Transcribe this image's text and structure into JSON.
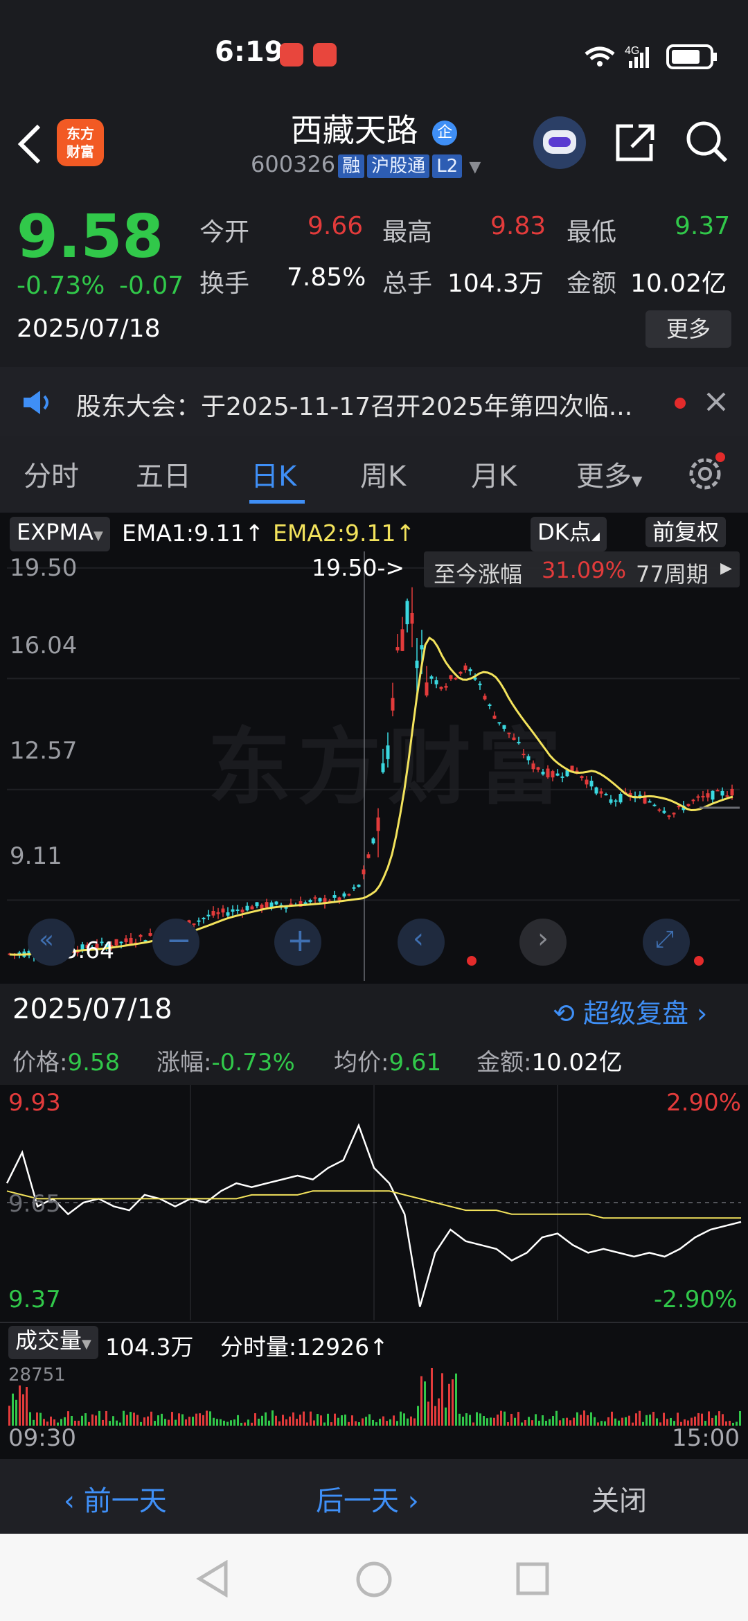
{
  "status_bar": {
    "time": "6:19",
    "network": "4G"
  },
  "header": {
    "title": "西藏天路",
    "title_badge": "企",
    "code": "600326",
    "tags": [
      "融",
      "沪股通",
      "L2"
    ],
    "logo_line1": "东方",
    "logo_line2": "财富"
  },
  "quote": {
    "price": "9.58",
    "change_pct": "-0.73%",
    "change": "-0.07",
    "date": "2025/07/18",
    "open_label": "今开",
    "open": "9.66",
    "high_label": "最高",
    "high": "9.83",
    "low_label": "最低",
    "low": "9.37",
    "turnover_label": "换手",
    "turnover": "7.85%",
    "volume_label": "总手",
    "volume": "104.3万",
    "amount_label": "金额",
    "amount": "10.02亿",
    "more_label": "更多"
  },
  "notice": {
    "text": "股东大会：于2025-11-17召开2025年第四次临..."
  },
  "tabs": [
    {
      "label": "分时"
    },
    {
      "label": "五日"
    },
    {
      "label": "日K"
    },
    {
      "label": "周K"
    },
    {
      "label": "月K"
    },
    {
      "label": "更多"
    }
  ],
  "kline": {
    "indicator": "EXPMA",
    "ema1": "EMA1:9.11↑",
    "ema2": "EMA2:9.11↑",
    "dk_label": "DK点",
    "adjust_label": "前复权",
    "y_ticks": [
      "19.50",
      "16.04",
      "12.57",
      "9.11"
    ],
    "max_marker": "19.50->",
    "min_marker": "<-5.64",
    "range_label": "至今涨幅",
    "range_value": "31.09%",
    "range_period": "77周期",
    "watermark": "东方财富"
  },
  "chart_data": {
    "type": "line",
    "title": "",
    "x": [
      "09:30",
      "",
      "",
      "",
      "",
      "",
      "",
      "",
      "",
      "",
      "",
      "",
      "",
      "",
      "",
      "",
      "",
      "",
      "",
      "",
      "",
      "",
      "",
      "",
      "",
      "",
      "",
      "",
      "",
      "",
      "",
      "",
      "",
      "",
      "",
      "",
      "",
      "",
      "",
      "",
      "",
      "",
      "",
      "",
      "",
      "",
      "",
      "",
      "15:00"
    ],
    "series": [
      {
        "name": "",
        "values": [
          9.7,
          9.78,
          9.64,
          9.66,
          9.62,
          9.65,
          9.66,
          9.64,
          9.63,
          9.67,
          9.66,
          9.64,
          9.66,
          9.65,
          9.68,
          9.7,
          9.69,
          9.7,
          9.71,
          9.72,
          9.71,
          9.74,
          9.76,
          9.85,
          9.74,
          9.7,
          9.62,
          9.38,
          9.52,
          9.58,
          9.55,
          9.54,
          9.53,
          9.5,
          9.52,
          9.56,
          9.57,
          9.54,
          9.52,
          9.53,
          9.52,
          9.51,
          9.52,
          9.51,
          9.53,
          9.56,
          9.58,
          9.59,
          9.6
        ]
      },
      {
        "name": "均价",
        "values": [
          9.68,
          9.67,
          9.66,
          9.66,
          9.66,
          9.66,
          9.66,
          9.66,
          9.66,
          9.66,
          9.66,
          9.66,
          9.66,
          9.66,
          9.66,
          9.66,
          9.67,
          9.67,
          9.67,
          9.67,
          9.68,
          9.68,
          9.68,
          9.68,
          9.68,
          9.68,
          9.67,
          9.66,
          9.65,
          9.64,
          9.63,
          9.63,
          9.63,
          9.62,
          9.62,
          9.62,
          9.62,
          9.62,
          9.62,
          9.61,
          9.61,
          9.61,
          9.61,
          9.61,
          9.61,
          9.61,
          9.61,
          9.61,
          9.61
        ]
      }
    ],
    "ylim": [
      9.37,
      9.93
    ],
    "y_ticks": [
      "9.93",
      "9.65",
      "9.37"
    ],
    "y_ticks_right": [
      "2.90%",
      "-2.90%"
    ]
  },
  "detail": {
    "date": "2025/07/18",
    "replay_label": "超级复盘",
    "price_label": "价格:",
    "price": "9.58",
    "change_label": "涨幅:",
    "change": "-0.73%",
    "avg_label": "均价:",
    "avg": "9.61",
    "amount_label": "金额:",
    "amount": "10.02亿"
  },
  "volume": {
    "label": "成交量",
    "total": "104.3万",
    "minute_label": "分时量:12926↑",
    "max": "28751",
    "start": "09:30",
    "end": "15:00"
  },
  "bottom": {
    "prev": "前一天",
    "next": "后一天",
    "close": "关闭"
  }
}
